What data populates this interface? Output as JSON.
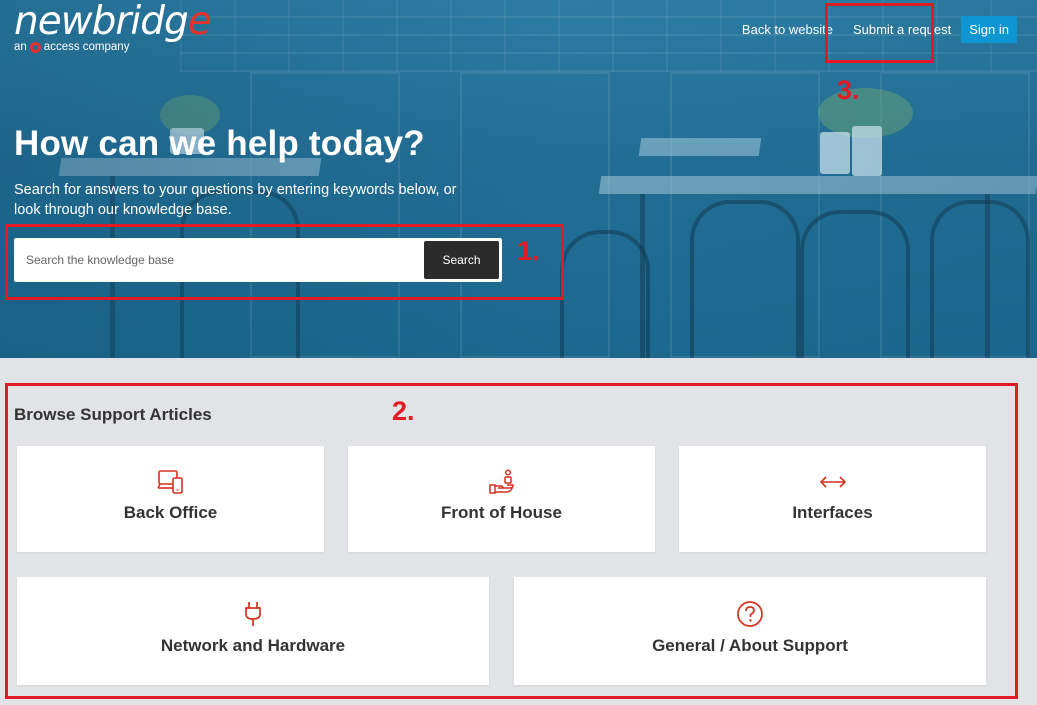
{
  "brand": {
    "logo_main": "newbridg",
    "logo_accent": "e",
    "logo_sub_left": "an",
    "logo_sub_right": "access company",
    "accent_color": "#e4312b"
  },
  "nav": {
    "back_to_website": "Back to website",
    "submit_request": "Submit a request",
    "sign_in": "Sign in"
  },
  "hero": {
    "title": "How can we help today?",
    "subtitle": "Search for answers to your questions by entering keywords below, or look through our knowledge base."
  },
  "search": {
    "placeholder": "Search the knowledge base",
    "button_label": "Search"
  },
  "annotations": {
    "one": "1.",
    "two": "2.",
    "three": "3."
  },
  "browse": {
    "title": "Browse Support Articles",
    "categories": [
      {
        "label": "Back Office",
        "icon": "devices-icon"
      },
      {
        "label": "Front of House",
        "icon": "hand-service-icon"
      },
      {
        "label": "Interfaces",
        "icon": "double-arrow-icon"
      },
      {
        "label": "Network and Hardware",
        "icon": "plug-icon"
      },
      {
        "label": "General / About Support",
        "icon": "question-circle-icon"
      }
    ]
  },
  "colors": {
    "icon_red": "#d4321f",
    "annotation_red": "#e01b24",
    "sign_in_blue": "#0e96d2"
  }
}
